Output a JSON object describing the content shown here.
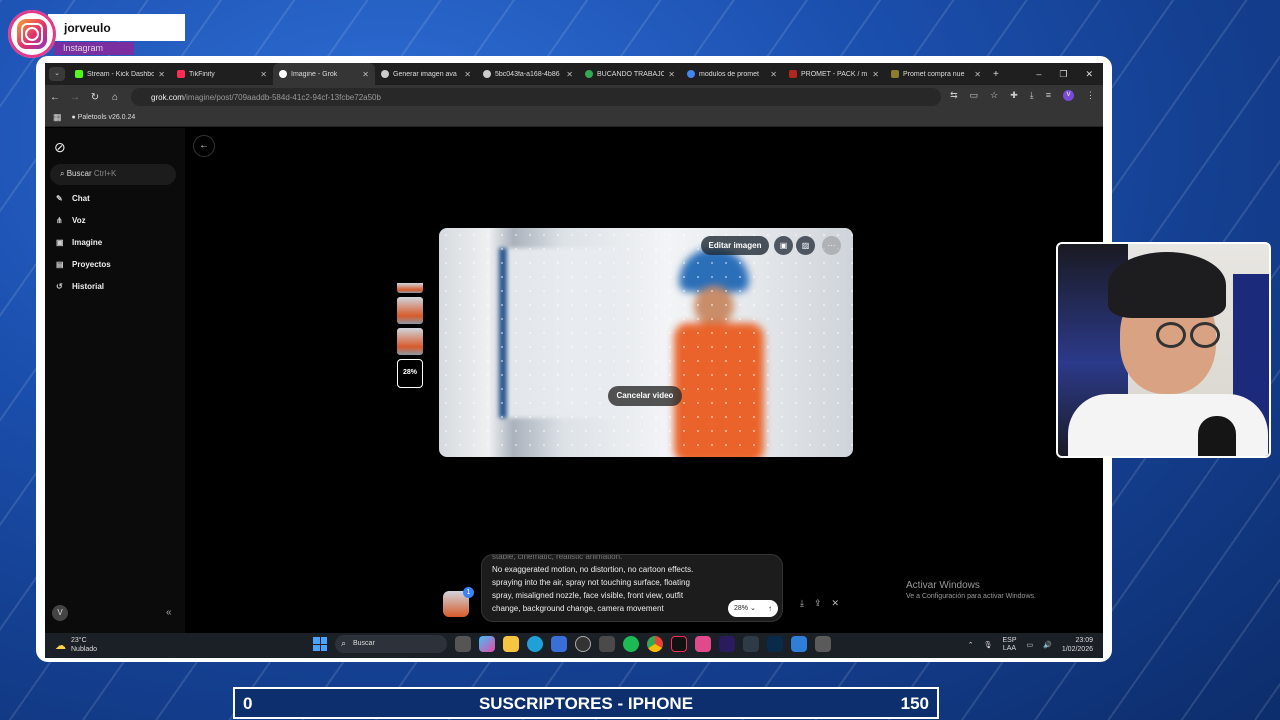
{
  "overlay": {
    "instagram_name": "jorveulo",
    "instagram_label": "Instagram"
  },
  "browser": {
    "tabs": [
      {
        "title": "Stream - Kick Dashbo",
        "color": "#53fc18"
      },
      {
        "title": "TikFinity",
        "color": "#ff2d55"
      },
      {
        "title": "Imagine - Grok",
        "color": "#ffffff",
        "active": true
      },
      {
        "title": "Generar imagen ava",
        "color": "#cccccc"
      },
      {
        "title": "5bc043fa-a168-4b86",
        "color": "#cccccc"
      },
      {
        "title": "BUCANDO TRABAJO",
        "color": "#34a853"
      },
      {
        "title": "modulos de promet",
        "color": "#4285f4"
      },
      {
        "title": "PROMET - PACK / m",
        "color": "#b3261e"
      },
      {
        "title": "Promet compra nue",
        "color": "#8a7d2e"
      }
    ],
    "url_host": "grok.com",
    "url_path": "/imagine/post/709aaddb-584d-41c2-94cf-13fcbe72a50b",
    "bookmark": "Paletools v26.0.24",
    "profile_initial": "V"
  },
  "sidebar": {
    "search_label": "Buscar",
    "search_shortcut": "Ctrl+K",
    "items": [
      {
        "label": "Chat",
        "icon": "chat-icon"
      },
      {
        "label": "Voz",
        "icon": "voice-icon"
      },
      {
        "label": "Imagine",
        "icon": "image-icon"
      },
      {
        "label": "Proyectos",
        "icon": "folder-icon"
      },
      {
        "label": "Historial",
        "icon": "history-icon"
      }
    ],
    "user_initial": "V"
  },
  "viewer": {
    "edit_label": "Editar imagen",
    "cancel_label": "Cancelar video",
    "progress_label": "28%",
    "progress": 0.28
  },
  "prompt": {
    "cut_line": "stable, cinematic, realistic animation.",
    "line1": "No exaggerated motion, no distortion, no cartoon effects.",
    "line2": "spraying into the air, spray not touching surface, floating",
    "line3": "spray, misaligned nozzle, face visible, front view, outfit",
    "line4": "change, background change, camera movement",
    "progress_label": "28%",
    "notification_count": "1"
  },
  "windows_activation": {
    "title": "Activar Windows",
    "subtitle": "Ve a Configuración para activar Windows."
  },
  "taskbar": {
    "temperature": "23°C",
    "weather": "Nublado",
    "search_placeholder": "Buscar",
    "lang1": "ESP",
    "lang2": "LAA",
    "time": "23:09",
    "date": "1/02/2026"
  },
  "counter": {
    "start": "0",
    "title": "SUSCRIPTORES - IPHONE",
    "goal": "150"
  }
}
